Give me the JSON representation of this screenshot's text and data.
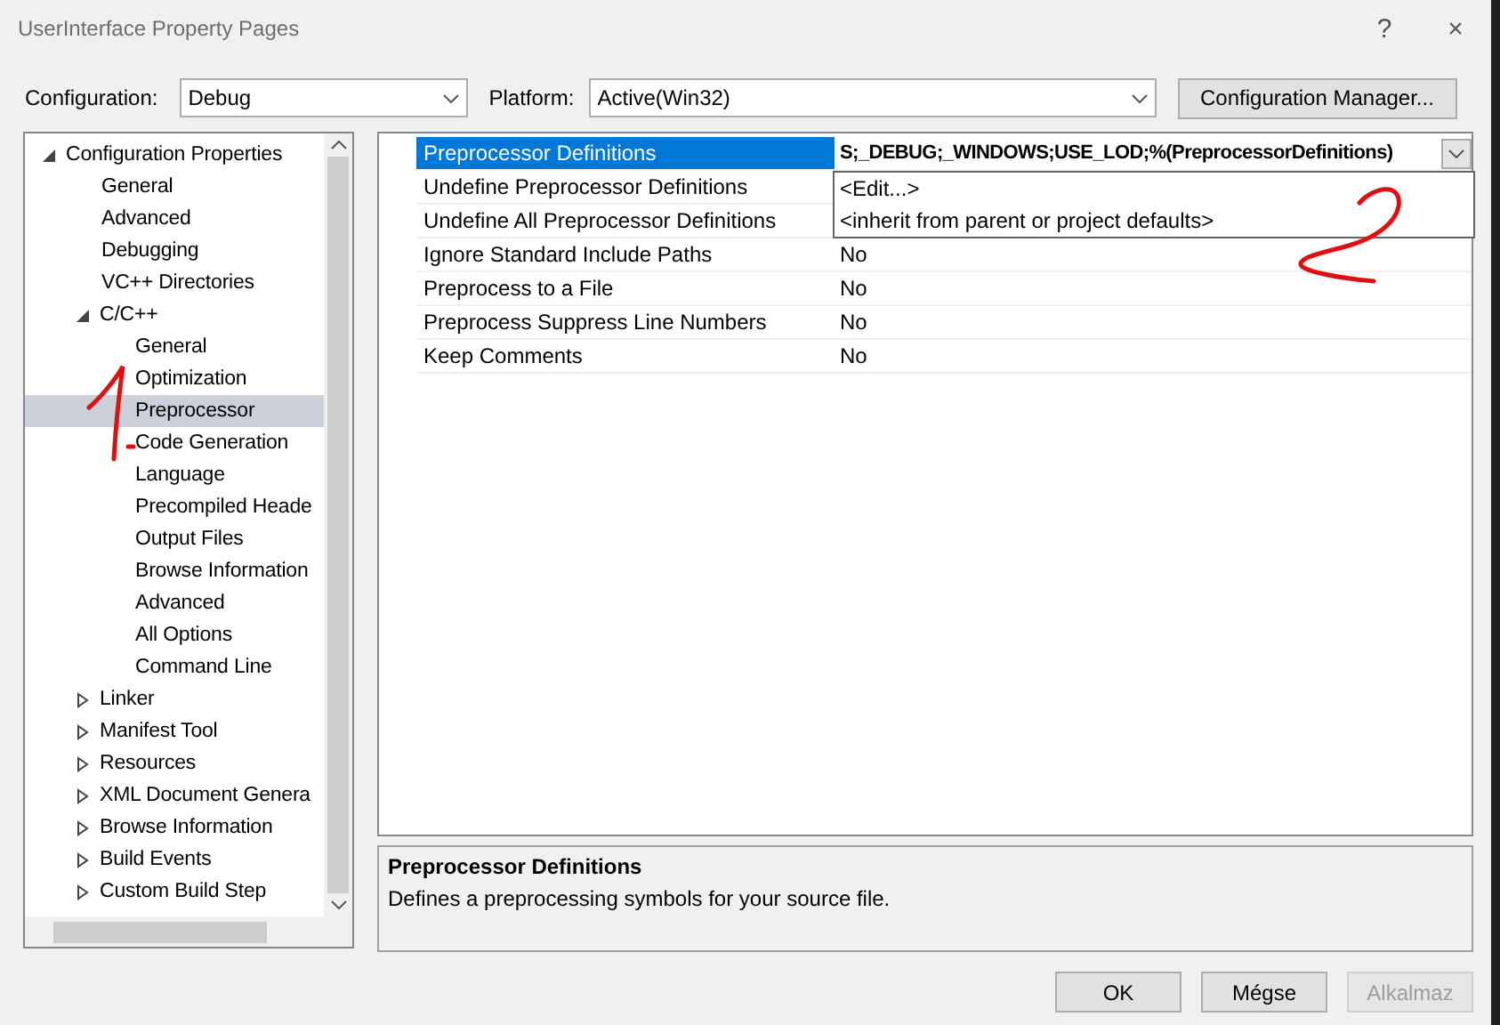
{
  "window": {
    "title": "UserInterface Property Pages",
    "help": "?",
    "close": "×"
  },
  "toolbar": {
    "configuration_label": "Configuration:",
    "configuration": "Debug",
    "platform_label": "Platform:",
    "platform": "Active(Win32)",
    "manager_button": "Configuration Manager..."
  },
  "tree": [
    {
      "label": "Configuration Properties",
      "expanded": true,
      "selected": false,
      "children": [
        {
          "label": "General",
          "selected": false
        },
        {
          "label": "Advanced",
          "selected": false
        },
        {
          "label": "Debugging",
          "selected": false
        },
        {
          "label": "VC++ Directories",
          "selected": false
        },
        {
          "label": "C/C++",
          "expanded": true,
          "selected": false,
          "children": [
            {
              "label": "General",
              "selected": false
            },
            {
              "label": "Optimization",
              "selected": false
            },
            {
              "label": "Preprocessor",
              "selected": true
            },
            {
              "label": "Code Generation",
              "selected": false
            },
            {
              "label": "Language",
              "selected": false
            },
            {
              "label": "Precompiled Heade",
              "selected": false
            },
            {
              "label": "Output Files",
              "selected": false
            },
            {
              "label": "Browse Information",
              "selected": false
            },
            {
              "label": "Advanced",
              "selected": false
            },
            {
              "label": "All Options",
              "selected": false
            },
            {
              "label": "Command Line",
              "selected": false
            }
          ]
        },
        {
          "label": "Linker",
          "expanded": false,
          "selected": false
        },
        {
          "label": "Manifest Tool",
          "expanded": false,
          "selected": false
        },
        {
          "label": "Resources",
          "expanded": false,
          "selected": false
        },
        {
          "label": "XML Document Genera",
          "expanded": false,
          "selected": false
        },
        {
          "label": "Browse Information",
          "expanded": false,
          "selected": false
        },
        {
          "label": "Build Events",
          "expanded": false,
          "selected": false
        },
        {
          "label": "Custom Build Step",
          "expanded": false,
          "selected": false
        }
      ]
    }
  ],
  "properties": [
    {
      "name": "Preprocessor Definitions",
      "value": "S;_DEBUG;_WINDOWS;USE_LOD;%(PreprocessorDefinitions)",
      "selected": true
    },
    {
      "name": "Undefine Preprocessor Definitions",
      "selected": false
    },
    {
      "name": "Undefine All Preprocessor Definitions",
      "selected": false
    },
    {
      "name": "Ignore Standard Include Paths",
      "value": "No",
      "selected": false
    },
    {
      "name": "Preprocess to a File",
      "value": "No",
      "selected": false
    },
    {
      "name": "Preprocess Suppress Line Numbers",
      "value": "No",
      "selected": false
    },
    {
      "name": "Keep Comments",
      "value": "No",
      "selected": false
    }
  ],
  "dropdown": [
    "<Edit...>",
    "<inherit from parent or project defaults>"
  ],
  "description": {
    "title": "Preprocessor Definitions",
    "text": "Defines a preprocessing symbols for your source file."
  },
  "buttons": [
    {
      "label": "OK",
      "disabled": false
    },
    {
      "label": "Mégse",
      "disabled": false
    },
    {
      "label": "Alkalmaz",
      "disabled": true
    }
  ]
}
